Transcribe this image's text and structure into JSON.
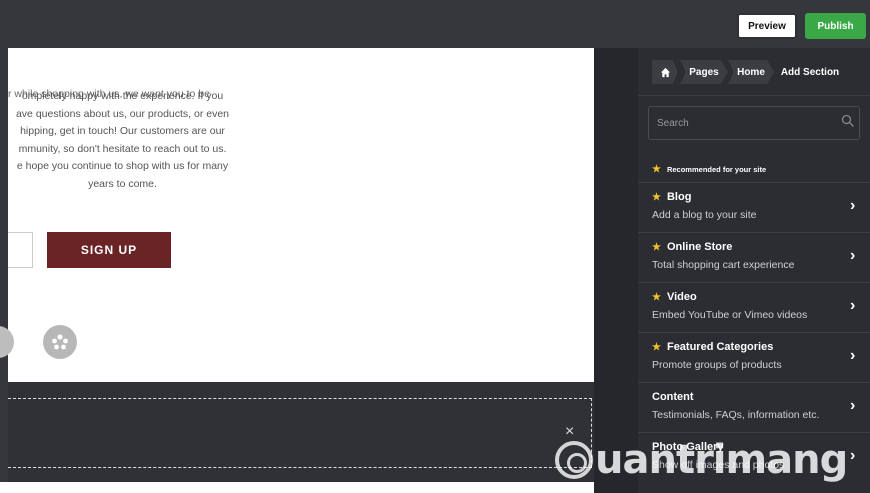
{
  "topbar": {
    "preview_label": "Preview",
    "publish_label": "Publish"
  },
  "canvas": {
    "paragraph_lines": [
      "ompletely happy with the experience. If you",
      "ave questions about us, our products, or even",
      "hipping, get in touch! Our customers are our",
      "mmunity, so don't hesitate to reach out to us.",
      "e hope you continue to shop with us for many",
      "years to come."
    ],
    "cut_line": "r while shopping with us, we want you to be",
    "signup_label": "SIGN UP",
    "social_icons": [
      "social-icon",
      "yelp-icon"
    ],
    "close_glyph": "×"
  },
  "panel": {
    "breadcrumb": {
      "home_icon": "home-icon",
      "pages": "Pages",
      "home": "Home",
      "add_section": "Add Section"
    },
    "search_placeholder": "Search",
    "recommended_label": "Recommended for your site",
    "items": [
      {
        "title": "Blog",
        "desc": "Add a blog to your site",
        "starred": true
      },
      {
        "title": "Online Store",
        "desc": "Total shopping cart experience",
        "starred": true
      },
      {
        "title": "Video",
        "desc": "Embed YouTube or Vimeo videos",
        "starred": true
      },
      {
        "title": "Featured Categories",
        "desc": "Promote groups of products",
        "starred": true
      },
      {
        "title": "Content",
        "desc": "Testimonials, FAQs, information etc.",
        "starred": false
      },
      {
        "title": "Photo Gallery",
        "desc": "Show off images and photos",
        "starred": false
      }
    ]
  },
  "watermark": {
    "text": "uantrimang"
  },
  "colors": {
    "topbar": "#35373d",
    "panel": "#2b2d32",
    "publish": "#3aa847",
    "signup": "#6a2425",
    "star": "#f2c22b"
  }
}
